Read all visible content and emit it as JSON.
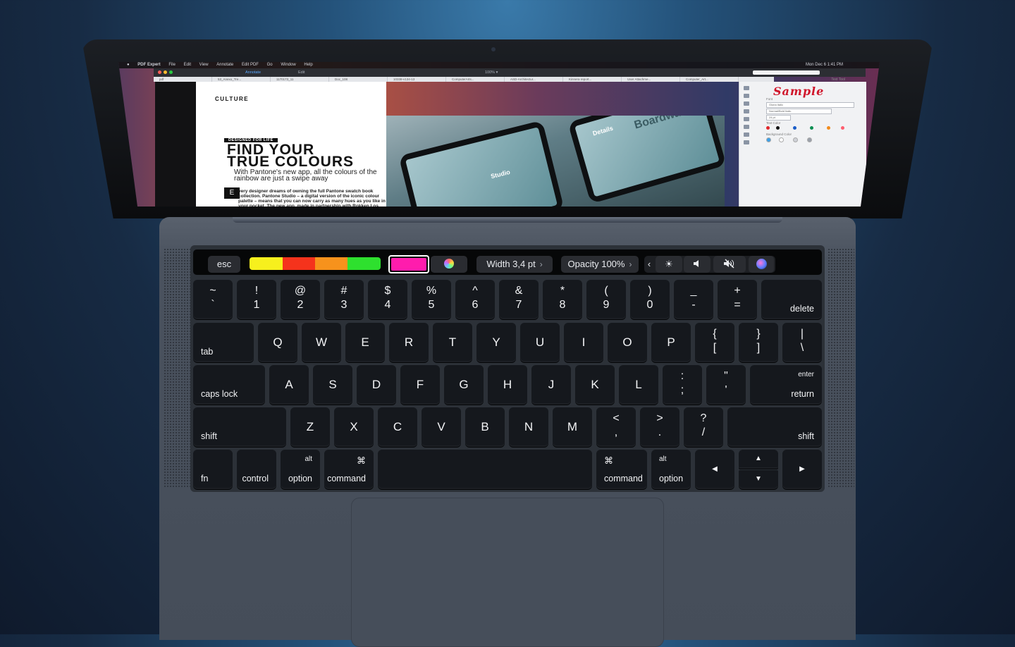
{
  "screen": {
    "menubar": {
      "app": "PDF Expert",
      "items": [
        "File",
        "Edit",
        "View",
        "Annotate",
        "Edit PDF",
        "Go",
        "Window",
        "Help"
      ],
      "clock": "Mon Dec 6  1:41 PM"
    },
    "toolbar": {
      "annotate": "Annotate",
      "edit": "Edit",
      "zoom": "100% ▾"
    },
    "tabs": [
      "pdf",
      "53_Anexo_Tre...",
      "1170173_11",
      "Doc_108",
      "10338-v134-13",
      "ComputerArts...",
      "ASD-Architectur...",
      "Kinnera report...",
      "User Attachme...",
      "Computer_Art..."
    ],
    "document": {
      "section": "CULTURE",
      "kicker": "DESIGNED FOR LIFE",
      "headline_line1": "FIND YOUR",
      "headline_line2": "TRUE COLOURS",
      "standfirst": "With Pantone's new app, all the colours of the rainbow are just a swipe away",
      "dropcap": "E",
      "body": "very designer dreams of owning the full Pantone swatch book collection. Pantone Studio – a digital version of the iconic colour palette – means that you can now carry as many hues as you like in your pocket. The new app, made in partnership with Rokken Los Angeles, allows users to explore different colours, create their",
      "photo_labels": {
        "details": "Details",
        "boardwalk": "Boardwal",
        "studio": "Studio"
      }
    },
    "inspector": {
      "title": "Text Tool",
      "sample": "Sample",
      "font_label": "Font",
      "font_value": "Gloria Italic",
      "style_value": "Normal/Bold Italic",
      "size_value": "24 pt",
      "text_color_label": "Text Color",
      "bg_color_label": "Background Color",
      "text_colors": [
        "#e0262a",
        "#111111",
        "#1a5dc8",
        "#0e8f53",
        "#f28b1c",
        "#ff5e6e"
      ],
      "bg_colors": [
        "#3aa0e8",
        "#ffffff",
        "#cfd2d8",
        "#9aa0aa"
      ]
    }
  },
  "touchbar": {
    "esc": "esc",
    "color_swatches": [
      "#f7f01d",
      "#f5331c",
      "#f7921c",
      "#2ee02e"
    ],
    "selected_color": "#ff1cad",
    "width_label": "Width 3,4 pt",
    "opacity_label": "Opacity 100%",
    "chevron": "›",
    "collapse": "‹",
    "brightness_icon": "☀",
    "volume_icon": "🔈",
    "mute_icon": "🔇"
  },
  "keyboard": {
    "row1": [
      {
        "top": "~",
        "bot": "`"
      },
      {
        "top": "!",
        "bot": "1"
      },
      {
        "top": "@",
        "bot": "2"
      },
      {
        "top": "#",
        "bot": "3"
      },
      {
        "top": "$",
        "bot": "4"
      },
      {
        "top": "%",
        "bot": "5"
      },
      {
        "top": "^",
        "bot": "6"
      },
      {
        "top": "&",
        "bot": "7"
      },
      {
        "top": "*",
        "bot": "8"
      },
      {
        "top": "(",
        "bot": "9"
      },
      {
        "top": ")",
        "bot": "0"
      },
      {
        "top": "_",
        "bot": "-"
      },
      {
        "top": "+",
        "bot": "="
      }
    ],
    "delete": "delete",
    "tab": "tab",
    "row2": [
      "Q",
      "W",
      "E",
      "R",
      "T",
      "Y",
      "U",
      "I",
      "O",
      "P"
    ],
    "row2_sym": [
      {
        "top": "{",
        "bot": "["
      },
      {
        "top": "}",
        "bot": "]"
      },
      {
        "top": "|",
        "bot": "\\"
      }
    ],
    "caps_lock": "caps lock",
    "row3": [
      "A",
      "S",
      "D",
      "F",
      "G",
      "H",
      "J",
      "K",
      "L"
    ],
    "row3_sym": [
      {
        "top": ":",
        "bot": ";"
      },
      {
        "top": "\"",
        "bot": "'"
      }
    ],
    "enter": "enter",
    "return": "return",
    "shift": "shift",
    "row4": [
      "Z",
      "X",
      "C",
      "V",
      "B",
      "N",
      "M"
    ],
    "row4_sym": [
      {
        "top": "<",
        "bot": ","
      },
      {
        "top": ">",
        "bot": "."
      },
      {
        "top": "?",
        "bot": "/"
      }
    ],
    "fn": "fn",
    "control": "control",
    "alt": "alt",
    "option": "option",
    "cmd_symbol": "⌘",
    "command": "command",
    "arrows": {
      "left": "◀",
      "up": "▲",
      "down": "▼",
      "right": "▶"
    }
  }
}
